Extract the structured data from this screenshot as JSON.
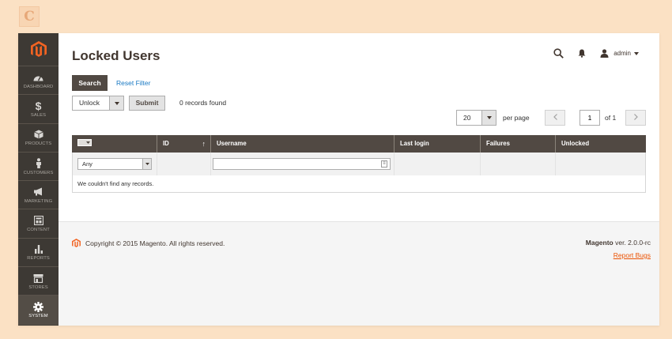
{
  "brand_mark": "C",
  "sidebar": {
    "items": [
      {
        "label": "Dashboard",
        "icon": "dashboard-icon"
      },
      {
        "label": "Sales",
        "icon": "dollar-icon",
        "glyph": "$"
      },
      {
        "label": "Products",
        "icon": "box-icon"
      },
      {
        "label": "Customers",
        "icon": "person-icon"
      },
      {
        "label": "Marketing",
        "icon": "megaphone-icon"
      },
      {
        "label": "Content",
        "icon": "layout-icon"
      },
      {
        "label": "Reports",
        "icon": "bar-chart-icon"
      },
      {
        "label": "Stores",
        "icon": "store-icon"
      },
      {
        "label": "System",
        "icon": "gear-icon",
        "active": true
      }
    ]
  },
  "header": {
    "title": "Locked Users",
    "user_name": "admin"
  },
  "actions": {
    "search_label": "Search",
    "reset_filter_label": "Reset Filter",
    "massaction_value": "Unlock",
    "submit_label": "Submit",
    "records_found": "0 records found"
  },
  "pager": {
    "per_page_value": "20",
    "per_page_label": "per page",
    "current_page": "1",
    "of_label": "of 1"
  },
  "grid": {
    "columns": [
      "",
      "ID",
      "Username",
      "Last login",
      "Failures",
      "Unlocked"
    ],
    "filter_any": "Any",
    "empty_message": "We couldn't find any records."
  },
  "footer": {
    "copyright": "Copyright © 2015 Magento. All rights reserved.",
    "version_brand": "Magento",
    "version_text": " ver. 2.0.0-rc",
    "report_bugs": "Report Bugs"
  },
  "colors": {
    "accent": "#eb5202",
    "sidebar_bg": "#3d3934",
    "grid_header": "#514943",
    "link": "#1979c3"
  }
}
